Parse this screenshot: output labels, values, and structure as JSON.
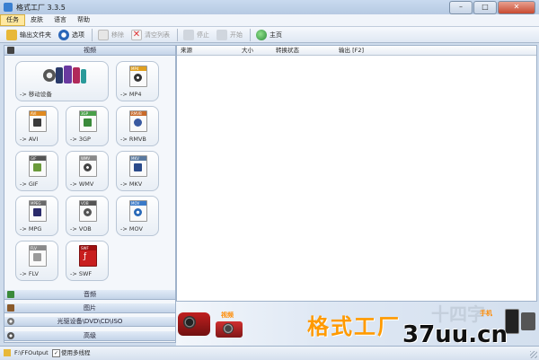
{
  "window": {
    "title": "格式工厂 3.3.5",
    "min": "–",
    "max": "□",
    "close": "✕"
  },
  "menu": [
    "任务",
    "皮肤",
    "语言",
    "帮助"
  ],
  "toolbar": {
    "output_folder": "输出文件夹",
    "options": "选项",
    "remove": "移除",
    "clear_list": "清空列表",
    "stop": "停止",
    "start": "开始",
    "home": "主页"
  },
  "sections": {
    "video": "视频",
    "audio": "音频",
    "picture": "图片",
    "rom": "光驱设备\\DVD\\CD\\ISO",
    "advanced": "高级"
  },
  "tiles": [
    {
      "label": "-> 移动设备",
      "badge": ""
    },
    {
      "label": "-> MP4",
      "badge": "MP4"
    },
    {
      "label": "-> AVI",
      "badge": "AVI"
    },
    {
      "label": "-> 3GP",
      "badge": "3GP"
    },
    {
      "label": "-> RMVB",
      "badge": "RMVB"
    },
    {
      "label": "-> GIF",
      "badge": "GIF"
    },
    {
      "label": "-> WMV",
      "badge": "WMV"
    },
    {
      "label": "-> MKV",
      "badge": "MKV"
    },
    {
      "label": "-> MPG",
      "badge": "MPEG"
    },
    {
      "label": "-> VOB",
      "badge": "VOB"
    },
    {
      "label": "-> MOV",
      "badge": "MOV"
    },
    {
      "label": "-> FLV",
      "badge": "FLV"
    },
    {
      "label": "-> SWF",
      "badge": "SWF"
    }
  ],
  "table": {
    "headers": [
      "来源",
      "大小",
      "转换状态",
      "输出 [F2]"
    ]
  },
  "banner": {
    "logo": "格式工厂",
    "video": "视频",
    "phone": "手机",
    "watermark": "37uu.cn",
    "faint": "十四字"
  },
  "status": {
    "output_path": "F:\\FFOutput",
    "multithread": "使用多线程"
  }
}
